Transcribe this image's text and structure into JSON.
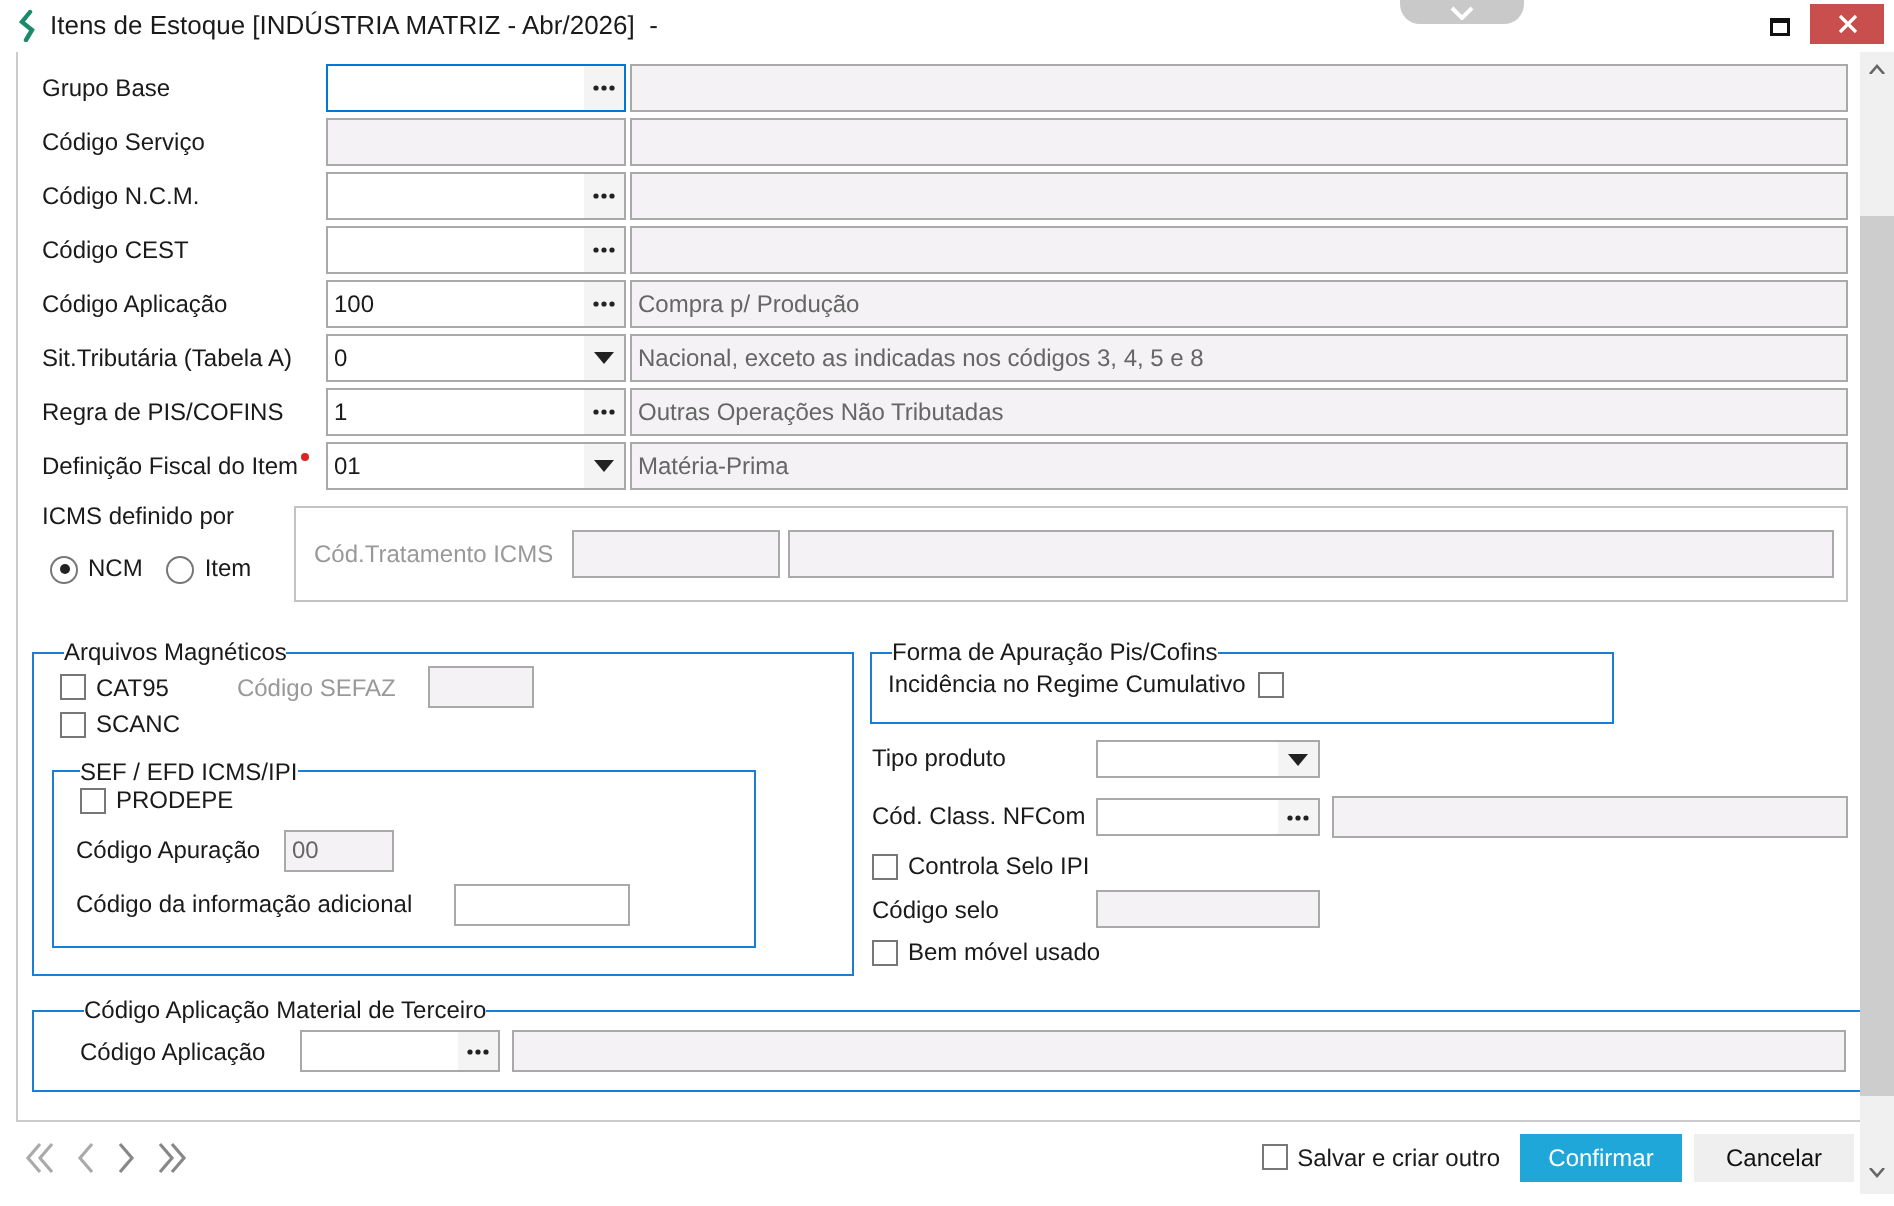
{
  "window": {
    "title": "Itens de Estoque [INDÚSTRIA MATRIZ - Abr/2026]  -"
  },
  "fields": [
    {
      "label": "Grupo Base",
      "required": false,
      "input": {
        "kind": "lookup",
        "focused": true,
        "disabled": false
      },
      "description": {
        "disabled": true
      }
    },
    {
      "label": "Código Serviço",
      "required": false,
      "input": {
        "kind": "plain",
        "focused": false,
        "disabled": true
      },
      "description": {
        "disabled": true
      }
    },
    {
      "label": "Código N.C.M.",
      "required": false,
      "input": {
        "kind": "lookup",
        "focused": false,
        "disabled": false
      },
      "description": {
        "disabled": true
      }
    },
    {
      "label": "Código CEST",
      "required": false,
      "input": {
        "kind": "lookup",
        "focused": false,
        "disabled": false
      },
      "description": {
        "disabled": true
      }
    },
    {
      "label": "Código Aplicação",
      "required": false,
      "input": {
        "kind": "lookup",
        "value": "100",
        "focused": false,
        "disabled": false
      },
      "description": {
        "text": "Compra p/ Produção",
        "disabled": true
      }
    },
    {
      "label": "Sit.Tributária (Tabela A)",
      "required": false,
      "input": {
        "kind": "select",
        "value": "0",
        "focused": false,
        "disabled": false
      },
      "description": {
        "text": "Nacional, exceto as indicadas nos códigos 3, 4, 5 e 8",
        "disabled": true
      }
    },
    {
      "label": "Regra de PIS/COFINS",
      "required": false,
      "input": {
        "kind": "lookup",
        "value": "1",
        "focused": false,
        "disabled": false
      },
      "description": {
        "text": "Outras Operações Não Tributadas",
        "disabled": true
      }
    },
    {
      "label": "Definição Fiscal do Item",
      "required": true,
      "input": {
        "kind": "select",
        "value": "01",
        "focused": false,
        "disabled": false
      },
      "description": {
        "text": "Matéria-Prima",
        "disabled": true
      }
    }
  ],
  "icms": {
    "label": "ICMS definido por",
    "options": [
      {
        "label": "NCM",
        "selected": true
      },
      {
        "label": "Item",
        "selected": false
      }
    ],
    "tratamento_label": "Cód.Tratamento ICMS"
  },
  "arquivos": {
    "legend": "Arquivos Magnéticos",
    "cat95": {
      "label": "CAT95",
      "checked": false
    },
    "sefaz_label": "Código SEFAZ",
    "scanc": {
      "label": "SCANC",
      "checked": false
    },
    "sef": {
      "legend": "SEF / EFD ICMS/IPI",
      "prodepe": {
        "label": "PRODEPE",
        "checked": false
      },
      "apuracao_label": "Código Apuração",
      "apuracao_value": "00",
      "info_label": "Código da informação adicional"
    }
  },
  "pis_cofins": {
    "legend": "Forma de Apuração Pis/Cofins",
    "label": "Incidência no Regime Cumulativo",
    "checked": false
  },
  "tipo_produto": {
    "label": "Tipo produto"
  },
  "nfcom": {
    "label": "Cód. Class. NFCom"
  },
  "selo_ipi": {
    "label": "Controla Selo IPI",
    "checked": false
  },
  "codigo_selo": {
    "label": "Código selo"
  },
  "bem_movel": {
    "label": "Bem móvel usado",
    "checked": false
  },
  "terceiro": {
    "legend": "Código Aplicação Material de Terceiro",
    "label": "Código Aplicação"
  },
  "footer": {
    "save_new": {
      "label": "Salvar e criar outro",
      "checked": false
    },
    "confirm": "Confirmar",
    "cancel": "Cancelar"
  }
}
